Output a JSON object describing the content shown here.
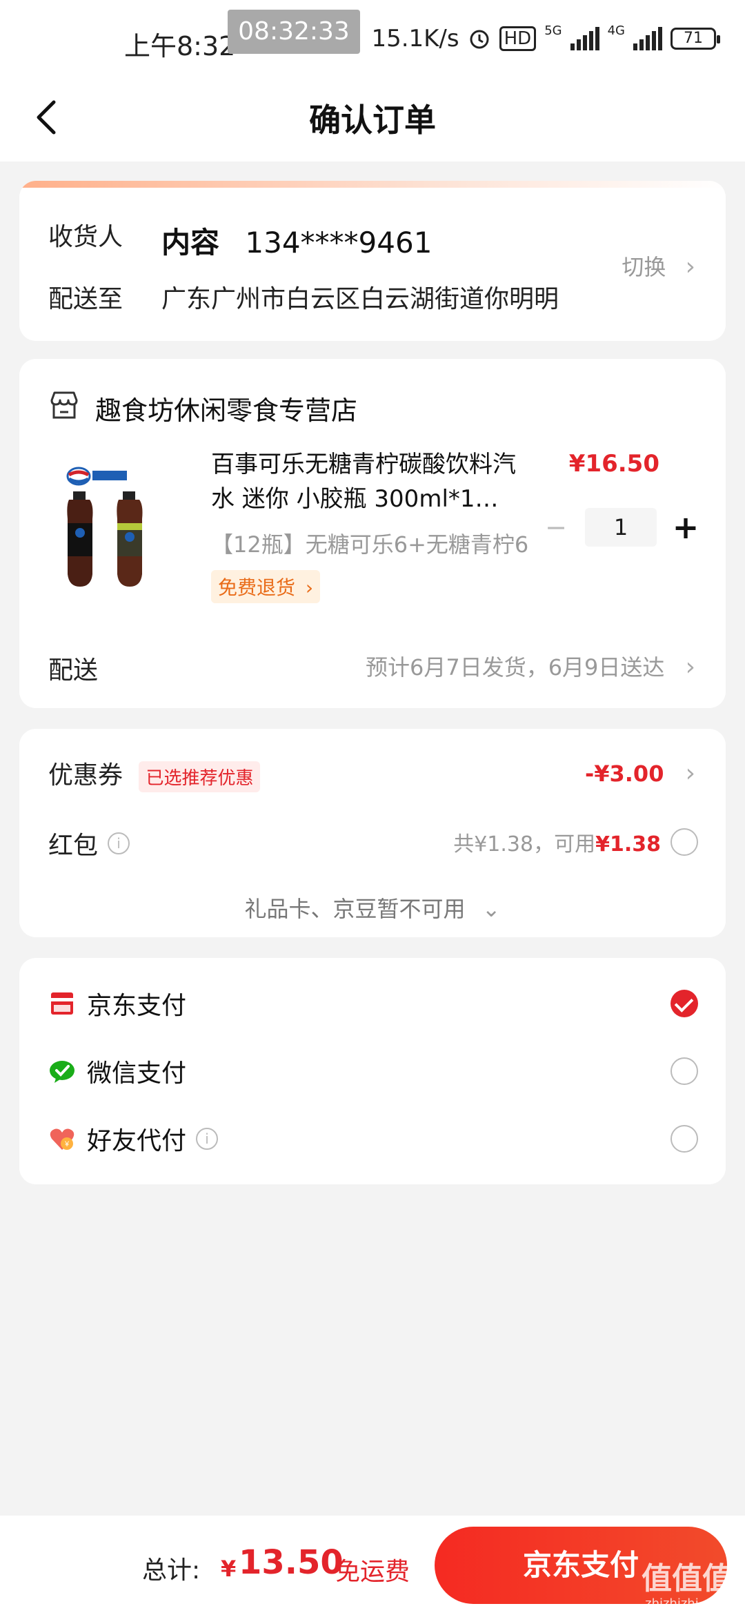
{
  "status_bar": {
    "time": "上午8:32",
    "overlay_time": "08:32:33",
    "net_speed": "15.1K/s",
    "hd": "HD",
    "net1": "5G",
    "net2": "4G",
    "battery": "71"
  },
  "header": {
    "title": "确认订单"
  },
  "address": {
    "recipient_label": "收货人",
    "recipient_name": "内容",
    "recipient_phone": "134****9461",
    "deliver_label": "配送至",
    "address": "广东广州市白云区白云湖街道你明明",
    "switch_label": "切换"
  },
  "store": {
    "name": "趣食坊休闲零食专营店",
    "product_title": "百事可乐无糖青柠碳酸饮料汽水 迷你 小胶瓶 300ml*1…",
    "product_spec": "【12瓶】无糖可乐6+无糖青柠6",
    "return_badge": "免费退货",
    "price": "¥16.50",
    "quantity": "1",
    "shipping_label": "配送",
    "shipping_info": "预计6月7日发货，6月9日送达"
  },
  "discounts": {
    "coupon_label": "优惠券",
    "coupon_tag": "已选推荐优惠",
    "coupon_value": "-¥3.00",
    "hongbao_label": "红包",
    "hongbao_total": "共¥1.38，可用",
    "hongbao_available": "¥1.38",
    "giftcard_note": "礼品卡、京豆暂不可用"
  },
  "payment": {
    "methods": [
      {
        "label": "京东支付",
        "selected": true
      },
      {
        "label": "微信支付",
        "selected": false
      },
      {
        "label": "好友代付",
        "selected": false
      }
    ]
  },
  "footer": {
    "total_label": "总计:",
    "currency": "¥",
    "total_value": "13.50",
    "free_shipping": "免运费",
    "pay_button": "京东支付",
    "watermark": "值值值",
    "watermark_sub": "zhizhizhi.com"
  },
  "colors": {
    "accent": "#e3242b",
    "badge": "#e96b18"
  }
}
